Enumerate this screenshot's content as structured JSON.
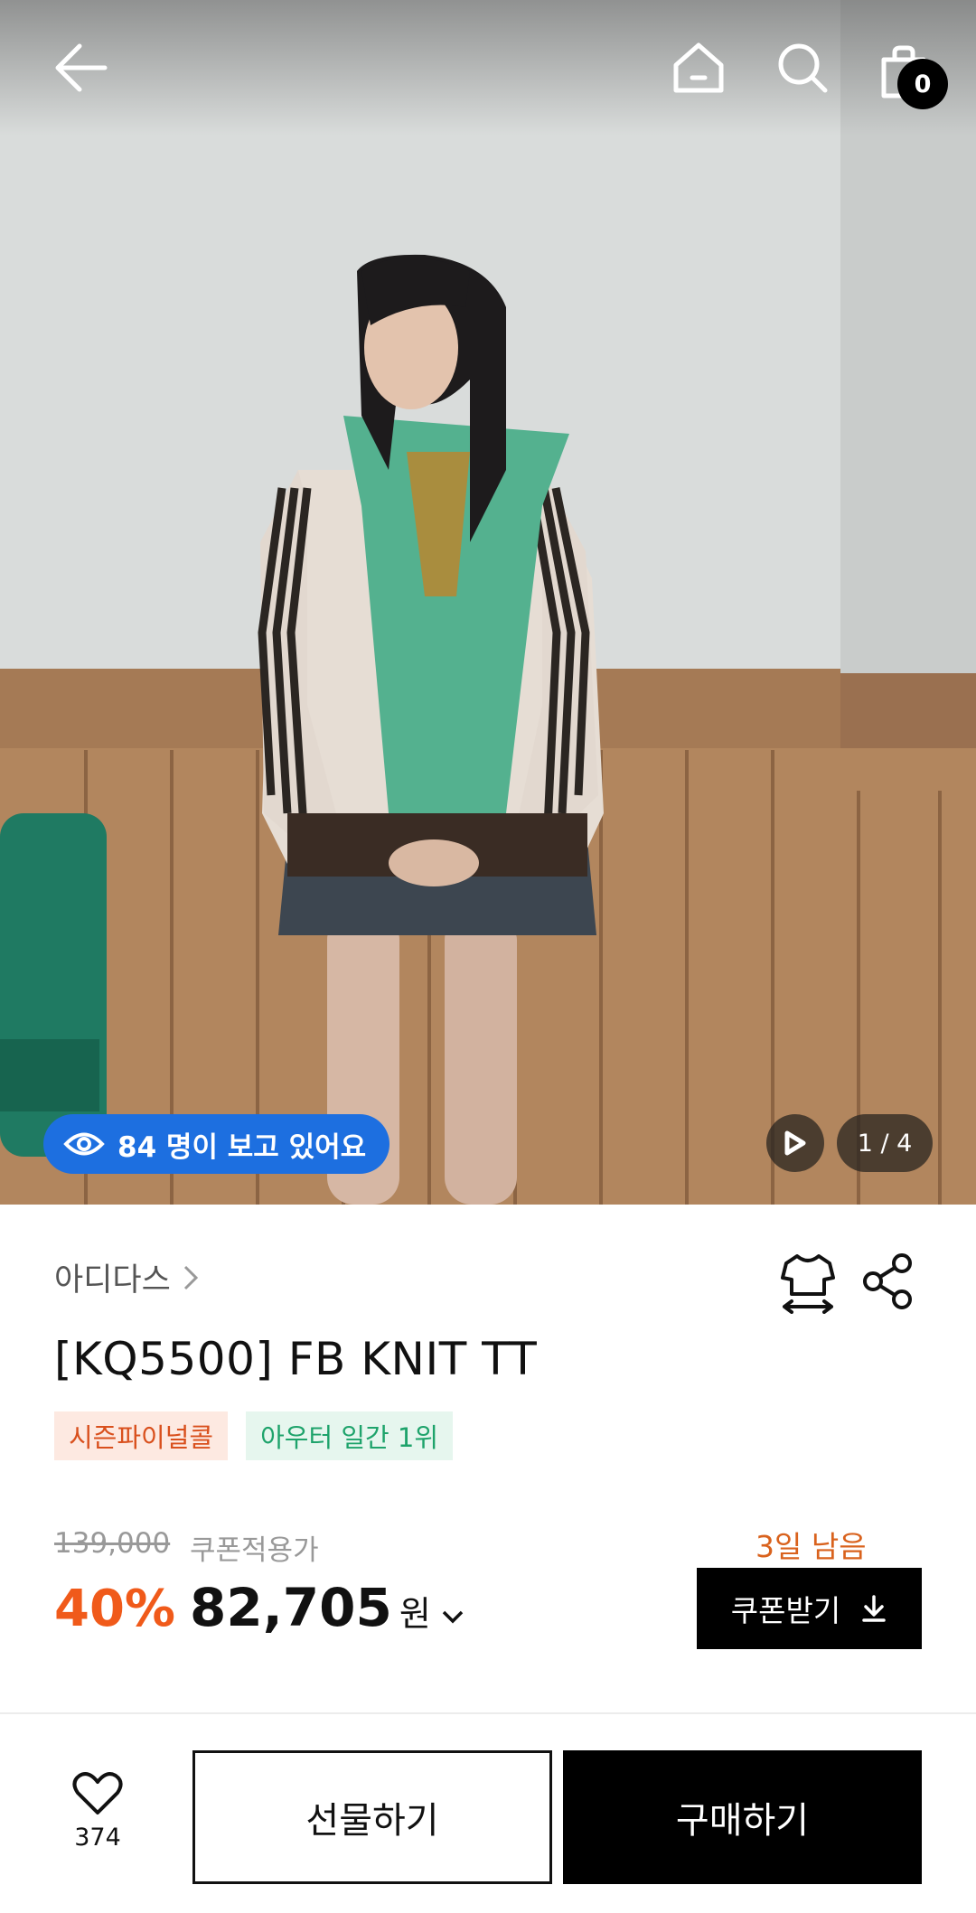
{
  "header": {
    "icons": [
      "back-arrow-icon",
      "home-icon",
      "search-icon",
      "shopping-bag-icon"
    ],
    "cart_count": "0"
  },
  "hero": {
    "viewers_label": "84 명이 보고 있어요",
    "page_indicator": "1 / 4",
    "play_icon": "play-icon"
  },
  "product": {
    "brand": "아디다스",
    "title": "[KQ5500] FB KNIT TT",
    "tags": [
      "시즌파이널콜",
      "아우터 일간 1위"
    ],
    "original_price": "139,000",
    "coupon_note": "쿠폰적용가",
    "discount": "40%",
    "price": "82,705",
    "currency": "원",
    "days_left": "3일 남음",
    "coupon_button": "쿠폰받기"
  },
  "bottom_bar": {
    "like_count": "374",
    "gift_button": "선물하기",
    "buy_button": "구매하기"
  },
  "colors": {
    "accent_orange": "#f05a1a",
    "viewers_blue": "#1d6fe0",
    "tag_season_text": "#d9501d",
    "tag_rank_text": "#1ea36b"
  }
}
